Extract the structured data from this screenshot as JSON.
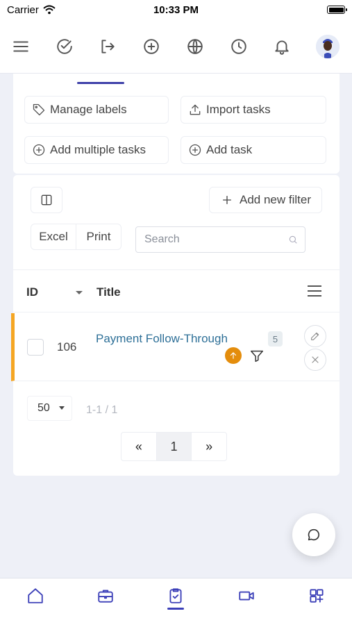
{
  "status_bar": {
    "carrier": "Carrier",
    "time": "10:33 PM"
  },
  "topnav": {
    "icons": [
      "menu-icon",
      "check-circle-icon",
      "logout-icon",
      "plus-circle-icon",
      "globe-icon",
      "clock-icon",
      "bell-icon",
      "avatar"
    ]
  },
  "actions": {
    "manage_labels": "Manage labels",
    "import_tasks": "Import tasks",
    "add_multiple_tasks": "Add multiple tasks",
    "add_task": "Add task"
  },
  "toolbar": {
    "add_new_filter": "Add new filter",
    "excel": "Excel",
    "print": "Print",
    "search_placeholder": "Search"
  },
  "table": {
    "columns": [
      "ID",
      "Title"
    ],
    "rows": [
      {
        "id": "106",
        "title": "Payment Follow-Through",
        "count": "5",
        "priority_color": "#e48d0c",
        "stripe_color": "#f5a623"
      }
    ]
  },
  "pagination": {
    "page_size": "50",
    "range": "1-1 / 1",
    "prev": "«",
    "current": "1",
    "next": "»"
  },
  "bottom_nav": {
    "items": [
      "home-icon",
      "briefcase-icon",
      "tasks-icon",
      "video-icon",
      "apps-icon"
    ],
    "active": "tasks-icon"
  },
  "colors": {
    "accent": "#3b3fb8",
    "link": "#2d6f97",
    "background": "#eef0f7"
  }
}
